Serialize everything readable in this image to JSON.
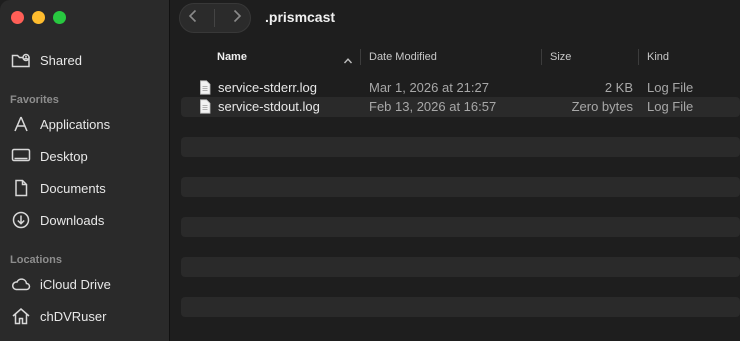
{
  "window": {
    "title": ".prismcast"
  },
  "sidebar": {
    "top_items": [
      {
        "label": "Shared",
        "icon": "shared-folder-icon"
      }
    ],
    "sections": [
      {
        "heading": "Favorites",
        "items": [
          {
            "label": "Applications",
            "icon": "applications-icon"
          },
          {
            "label": "Desktop",
            "icon": "desktop-icon"
          },
          {
            "label": "Documents",
            "icon": "document-icon"
          },
          {
            "label": "Downloads",
            "icon": "downloads-icon"
          }
        ]
      },
      {
        "heading": "Locations",
        "items": [
          {
            "label": "iCloud Drive",
            "icon": "cloud-icon"
          },
          {
            "label": "chDVRuser",
            "icon": "home-icon"
          }
        ]
      }
    ]
  },
  "columns": {
    "name": "Name",
    "date": "Date Modified",
    "size": "Size",
    "kind": "Kind"
  },
  "files": [
    {
      "name": "service-stderr.log",
      "date": "Mar 1, 2026 at 21:27",
      "size": "2 KB",
      "kind": "Log File"
    },
    {
      "name": "service-stdout.log",
      "date": "Feb 13, 2026 at 16:57",
      "size": "Zero bytes",
      "kind": "Log File"
    }
  ],
  "colors": {
    "background": "#1e1e1e",
    "sidebar": "#2a2a2a",
    "close": "#ff5f57",
    "minimize": "#febc2e",
    "maximize": "#28c840"
  }
}
